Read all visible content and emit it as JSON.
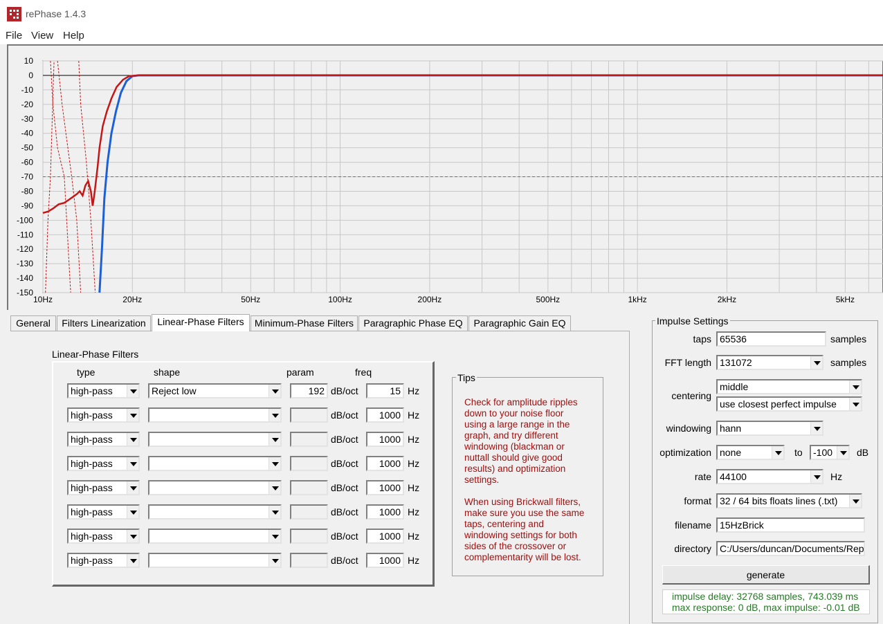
{
  "window": {
    "title": "rePhase 1.4.3"
  },
  "menu": [
    "File",
    "View",
    "Help"
  ],
  "graph": {
    "y_ticks": [
      "10",
      "0",
      "-10",
      "-20",
      "-30",
      "-40",
      "-50",
      "-60",
      "-70",
      "-80",
      "-90",
      "-100",
      "-110",
      "-120",
      "-130",
      "-140",
      "-150"
    ],
    "x_ticks": [
      "10Hz",
      "20Hz",
      "50Hz",
      "100Hz",
      "200Hz",
      "500Hz",
      "1kHz",
      "2kHz",
      "5kHz"
    ],
    "noise_floor_db": -70,
    "y_range": [
      -150,
      10
    ],
    "colors": {
      "red": "#c41616",
      "blue": "#1d5fd6",
      "noise": "#7b5fa0"
    }
  },
  "tabs": [
    "General",
    "Filters Linearization",
    "Linear-Phase Filters",
    "Minimum-Phase Filters",
    "Paragraphic Phase EQ",
    "Paragraphic Gain EQ"
  ],
  "active_tab": "Linear-Phase Filters",
  "linear_phase": {
    "title": "Linear-Phase Filters",
    "headers": {
      "type": "type",
      "shape": "shape",
      "param": "param",
      "freq": "freq"
    },
    "unit_param": "dB/oct",
    "unit_freq": "Hz",
    "rows": [
      {
        "type": "high-pass",
        "shape": "Reject low",
        "param": "192",
        "freq": "15"
      },
      {
        "type": "high-pass",
        "shape": "",
        "param": "",
        "freq": "1000"
      },
      {
        "type": "high-pass",
        "shape": "",
        "param": "",
        "freq": "1000"
      },
      {
        "type": "high-pass",
        "shape": "",
        "param": "",
        "freq": "1000"
      },
      {
        "type": "high-pass",
        "shape": "",
        "param": "",
        "freq": "1000"
      },
      {
        "type": "high-pass",
        "shape": "",
        "param": "",
        "freq": "1000"
      },
      {
        "type": "high-pass",
        "shape": "",
        "param": "",
        "freq": "1000"
      },
      {
        "type": "high-pass",
        "shape": "",
        "param": "",
        "freq": "1000"
      }
    ]
  },
  "tips": {
    "title": "Tips",
    "p1": [
      "Check for amplitude ripples",
      "down to your noise floor",
      "using a large range in the",
      "graph, and try different",
      "windowing (blackman or",
      "nuttall should give good",
      "results) and optimization",
      "settings."
    ],
    "p2": [
      "When using Brickwall filters,",
      "make sure you use the same",
      "taps, centering and",
      "windowing settings for both",
      "sides of the crossover or",
      "complementarity will be lost."
    ]
  },
  "impulse": {
    "title": "Impulse Settings",
    "taps_label": "taps",
    "taps": "65536",
    "samples_label": "samples",
    "fft_label": "FFT length",
    "fft": "131072",
    "centering_label": "centering",
    "centering": "middle",
    "centering2": "use closest perfect impulse",
    "windowing_label": "windowing",
    "windowing": "hann",
    "optimization_label": "optimization",
    "optimization": "none",
    "to_label": "to",
    "opt_db": "-100",
    "db_label": "dB",
    "rate_label": "rate",
    "rate": "44100",
    "hz_label": "Hz",
    "format_label": "format",
    "format": "32 / 64 bits floats lines (.txt)",
    "filename_label": "filename",
    "filename": "15HzBrick",
    "directory_label": "directory",
    "directory": "C:/Users/duncan/Documents/Rep",
    "generate": "generate",
    "status1": "impulse delay: 32768 samples, 743.039 ms",
    "status2": "max response: 0 dB, max impulse: -0.01 dB"
  }
}
